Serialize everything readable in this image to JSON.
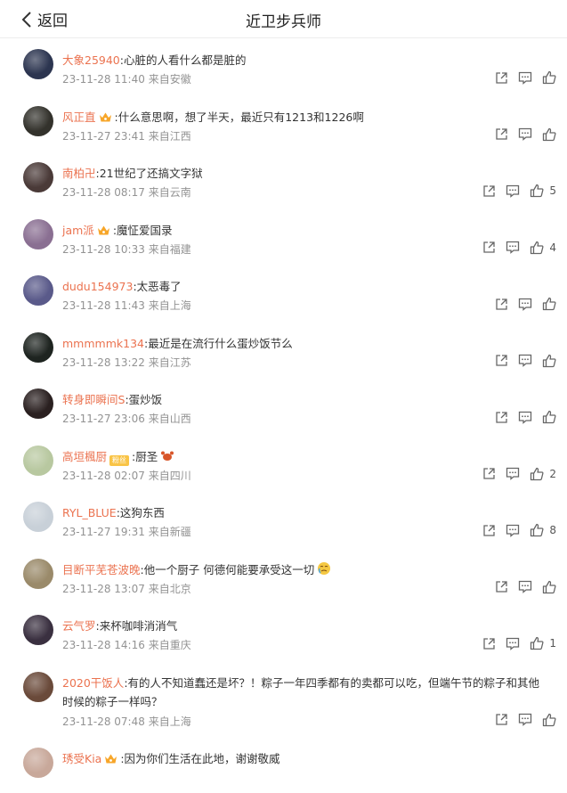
{
  "header": {
    "back_label": "返回",
    "title": "近卫步兵师"
  },
  "comments": [
    {
      "user": "大象25940",
      "text": ":心脏的人看什么都是脏的",
      "time": "23-11-28 11:40",
      "location": "来自安徽",
      "likes": "",
      "avatar_color": "#2c3550",
      "badge": ""
    },
    {
      "user": "风正直",
      "text": ":什么意思啊，想了半天，最近只有1213和1226啊",
      "time": "23-11-27 23:41",
      "location": "来自江西",
      "likes": "",
      "avatar_color": "#33322c",
      "badge": "crown"
    },
    {
      "user": "南柏卍",
      "text": ":21世纪了还搞文字狱",
      "time": "23-11-28 08:17",
      "location": "来自云南",
      "likes": "5",
      "avatar_color": "#4a3a38",
      "badge": ""
    },
    {
      "user": "jam派",
      "text": ":魔怔爱国录",
      "time": "23-11-28 10:33",
      "location": "来自福建",
      "likes": "4",
      "avatar_color": "#8a6f92",
      "badge": "crown"
    },
    {
      "user": "dudu154973",
      "text": ":太恶毒了",
      "time": "23-11-28 11:43",
      "location": "来自上海",
      "likes": "",
      "avatar_color": "#5a5a8a",
      "badge": ""
    },
    {
      "user": "mmmmmk134",
      "text": ":最近是在流行什么蛋炒饭节么",
      "time": "23-11-28 13:22",
      "location": "来自江苏",
      "likes": "",
      "avatar_color": "#1e2420",
      "badge": ""
    },
    {
      "user": "转身即瞬间S",
      "text": ":蛋炒饭",
      "time": "23-11-27 23:06",
      "location": "来自山西",
      "likes": "",
      "avatar_color": "#2a2020",
      "badge": ""
    },
    {
      "user": "高垣楓厨",
      "text": ":厨圣",
      "time": "23-11-28 02:07",
      "location": "来自四川",
      "likes": "2",
      "avatar_color": "#b8c8a0",
      "badge": "fan",
      "badge_text": "粉丝",
      "emoji_after": "crab"
    },
    {
      "user": "RYL_BLUE",
      "text": ":这狗东西",
      "time": "23-11-27 19:31",
      "location": "来自新疆",
      "likes": "8",
      "avatar_color": "#c8d0d8",
      "badge": ""
    },
    {
      "user": "目断平芜苍波晚",
      "text": ":他一个厨子 何德何能要承受这一切",
      "time": "23-11-28 13:07",
      "location": "来自北京",
      "likes": "",
      "avatar_color": "#9a8a6a",
      "badge": "",
      "emoji_after": "cry"
    },
    {
      "user": "云气罗",
      "text": ":来杯咖啡消消气",
      "time": "23-11-28 14:16",
      "location": "来自重庆",
      "likes": "1",
      "avatar_color": "#3a3040",
      "badge": ""
    },
    {
      "user": "2020干饭人",
      "text": ":有的人不知道蠢还是坏？！粽子一年四季都有的卖都可以吃，但端午节的粽子和其他时候的粽子一样吗？",
      "time": "23-11-28 07:48",
      "location": "来自上海",
      "likes": "",
      "avatar_color": "#6a4a3a",
      "badge": "",
      "tall": true
    },
    {
      "user": "琇受Kia",
      "text": ":因为你们生活在此地，谢谢敬威",
      "time": "",
      "location": "",
      "likes": "",
      "avatar_color": "#c8a89a",
      "badge": "crown"
    }
  ]
}
